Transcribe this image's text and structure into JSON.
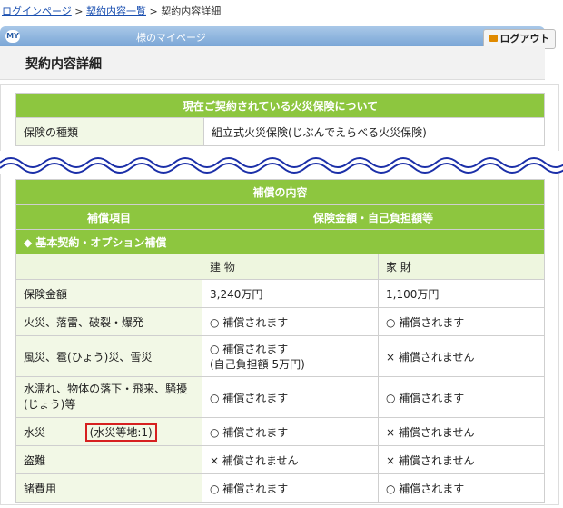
{
  "breadcrumb": {
    "items": [
      "ログインページ",
      "契約内容一覧",
      "契約内容詳細"
    ],
    "separator": ">"
  },
  "header": {
    "badge": "MY",
    "mypage_label": "様のマイページ",
    "logout_label": "ログアウト"
  },
  "page_title": "契約内容詳細",
  "section1": {
    "title": "現在ご契約されている火災保険について",
    "row_label": "保険の種類",
    "row_value": "組立式火災保険(じぶんでえらべる火災保険)"
  },
  "section2": {
    "title": "補償の内容",
    "col1": "補償項目",
    "col2": "保険金額・自己負担額等",
    "group": "◆ 基本契約・オプション補償",
    "sub_building": "建 物",
    "sub_contents": "家 財",
    "rows": [
      {
        "label": "保険金額",
        "building": "3,240万円",
        "contents": "1,100万円"
      },
      {
        "label": "火災、落雷、破裂・爆発",
        "building": "○ 補償されます",
        "contents": "○ 補償されます"
      },
      {
        "label": "風災、雹(ひょう)災、雪災",
        "building": "○ 補償されます",
        "building_note": "(自己負担額 5万円)",
        "contents": "× 補償されません"
      },
      {
        "label": "水濡れ、物体の落下・飛来、騒擾(じょう)等",
        "building": "○ 補償されます",
        "contents": "○ 補償されます"
      },
      {
        "label": "水災",
        "note": "(水災等地:1)",
        "building": "○ 補償されます",
        "contents": "× 補償されません"
      },
      {
        "label": "盗難",
        "building": "× 補償されません",
        "contents": "× 補償されません"
      },
      {
        "label": "諸費用",
        "building": "○ 補償されます",
        "contents": "○ 補償されます"
      }
    ]
  },
  "colors": {
    "green": "#8dc63f",
    "header_blue": "#7aa6d6",
    "highlight_red": "#d62020",
    "wave_blue": "#1b2fa8"
  }
}
